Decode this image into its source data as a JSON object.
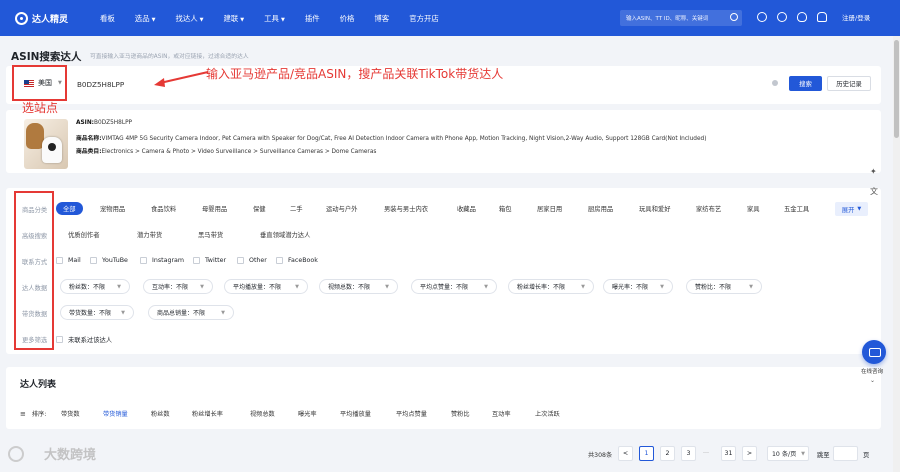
{
  "nav": {
    "brand": "达人精灵",
    "items": [
      {
        "label": "看板",
        "caret": false
      },
      {
        "label": "选品",
        "caret": true
      },
      {
        "label": "找达人",
        "caret": true
      },
      {
        "label": "建联",
        "caret": true
      },
      {
        "label": "工具",
        "caret": true
      },
      {
        "label": "插件",
        "caret": false
      },
      {
        "label": "价格",
        "caret": false
      },
      {
        "label": "博客",
        "caret": false
      },
      {
        "label": "官方开店",
        "caret": false
      }
    ],
    "search_placeholder": "输入ASIN、TT ID、昵称、关键词",
    "login": "注册/登录"
  },
  "page": {
    "title": "ASIN搜索达人",
    "subtitle": "可直接输入亚马逊商品的ASIN，或对应链接，过滤合适的达人"
  },
  "search": {
    "site": "美国",
    "asin": "B0DZ5H8LPP",
    "search_btn": "搜索",
    "history_btn": "历史记录"
  },
  "annotations": {
    "arrow_text": "输入亚马逊产品/竞品ASIN，搜产品关联TikTok带货达人",
    "site_text": "选站点",
    "color": "#e53935"
  },
  "product": {
    "asin_label": "ASIN:",
    "asin": "B0DZ5H8LPP",
    "name_label": "商品名称:",
    "name": "VIMTAG 4MP 5G Security Camera Indoor, Pet Camera with Speaker for Dog/Cat, Free AI Detection Indoor Camera with Phone App, Motion Tracking, Night Vision,2-Way Audio, Support 128GB Card(Not Included)",
    "cat_label": "商品类目:",
    "category": "Electronics > Camera & Photo > Video Surveillance > Surveillance Cameras > Dome Cameras"
  },
  "filters": {
    "labels": [
      "商品分类",
      "高级搜索",
      "联系方式",
      "达人数据",
      "带货数据",
      "更多筛选"
    ],
    "categories": [
      "全部",
      "宠物用品",
      "食品饮料",
      "母婴用品",
      "保健",
      "二手",
      "运动与户外",
      "男装与男士内衣",
      "收藏品",
      "箱包",
      "居家日用",
      "厨房用品",
      "玩具和爱好",
      "家纺布艺",
      "家具",
      "五金工具"
    ],
    "expand": "展开",
    "advanced": [
      "优质创作者",
      "潜力带货",
      "黑马带货",
      "垂直领域潜力达人"
    ],
    "contacts": [
      "Mail",
      "YouTuBe",
      "Instagram",
      "Twitter",
      "Other",
      "FaceBook"
    ],
    "creator_data": [
      "粉丝数：不限",
      "互动率：不限",
      "平均播放量：不限",
      "视频总数：不限",
      "平均点赞量：不限",
      "粉丝增长率：不限",
      "曝光率：不限",
      "赞粉比：不限"
    ],
    "sales_data": [
      "带货数量：不限",
      "商品总销量：不限"
    ],
    "more": [
      "未联系过该达人"
    ]
  },
  "list": {
    "title": "达人列表",
    "sort_label": "排序:",
    "sorts": [
      "带货数",
      "带货销量",
      "粉丝数",
      "粉丝增长率",
      "视频总数",
      "曝光率",
      "平均播放量",
      "平均点赞量",
      "赞粉比",
      "互动率",
      "上次活跃"
    ],
    "active_sort": "带货销量"
  },
  "pager": {
    "total": "共308条",
    "prev": "<",
    "pages": [
      "1",
      "2",
      "3"
    ],
    "ellipsis": "···",
    "last": "31",
    "next": ">",
    "size": "10 条/页",
    "jump_label": "跳至",
    "jump_unit": "页"
  },
  "side": {
    "consult": "在线咨询"
  },
  "watermark": "大数跨境"
}
